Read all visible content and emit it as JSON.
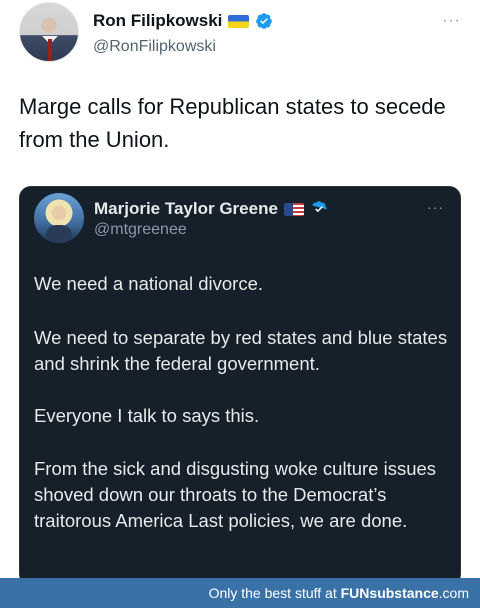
{
  "outer_tweet": {
    "author_name": "Ron Filipkowski",
    "handle": "@RonFilipkowski",
    "more": "···",
    "text": "Marge calls for Republican states to secede from the Union."
  },
  "quoted_tweet": {
    "author_name": "Marjorie Taylor Greene",
    "handle": "@mtgreenee",
    "more": "···",
    "paragraphs": [
      "We need a national divorce.",
      "We need to separate by red states and blue states and shrink the federal government.",
      "Everyone I talk to says this.",
      "From the sick and disgusting woke culture issues shoved down our throats to the Democrat’s traitorous America Last policies, we are done."
    ]
  },
  "footer": {
    "prefix": "Only the best stuff at ",
    "fun": "FUN",
    "substance": "substance",
    "com": ".com"
  },
  "icons": {
    "outer_flag": "ukraine-flag-icon",
    "outer_verified": "verified-badge-icon",
    "quoted_flag": "us-flag-icon",
    "quoted_verified": "verified-badge-icon"
  },
  "colors": {
    "verified": "#1d9bf0",
    "card_bg": "#15202b",
    "footer_bg": "#3a72a8"
  }
}
